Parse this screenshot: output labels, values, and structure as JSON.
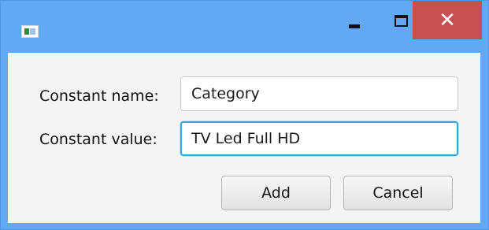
{
  "window": {
    "app_icon": "application-window-icon",
    "controls": {
      "minimize_icon": "minimize-icon",
      "maximize_icon": "maximize-icon",
      "close_icon": "close-icon",
      "close_glyph": "✕"
    },
    "close_color": "#c75050",
    "titlebar_color": "#61a9f2"
  },
  "form": {
    "name_label": "Constant name:",
    "name_value": "Category",
    "value_label": "Constant value:",
    "value_value": "TV Led Full HD",
    "focus_color": "#37a6d8"
  },
  "buttons": {
    "add_label": "Add",
    "cancel_label": "Cancel"
  }
}
